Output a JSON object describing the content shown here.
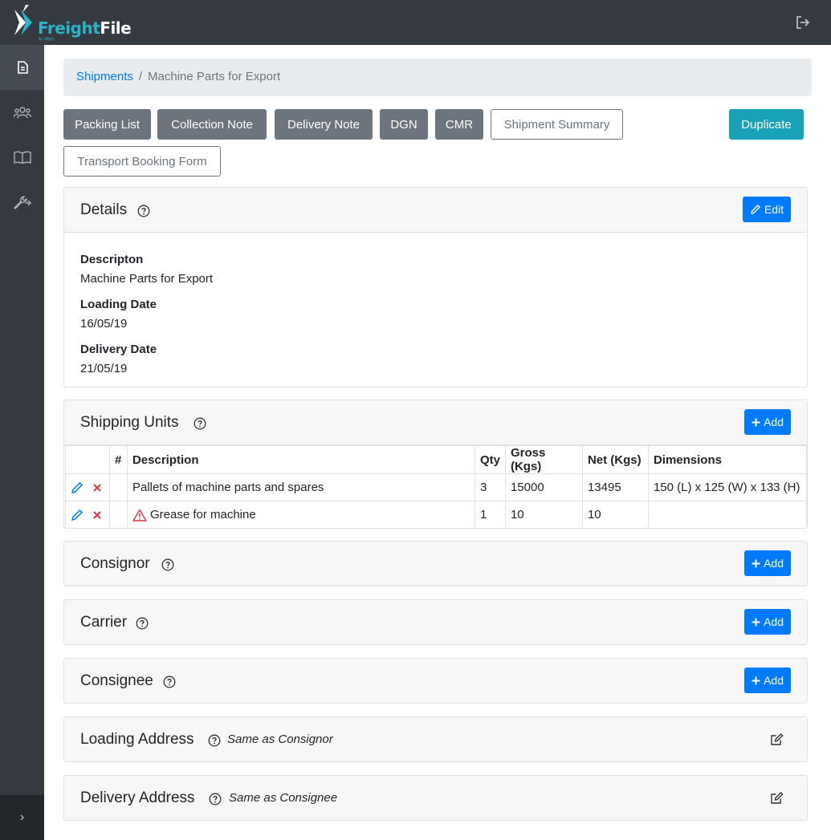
{
  "brand": {
    "name_part1": "Freight",
    "name_part2": "File",
    "byline": "by Sitpro",
    "accent": "#2bb3c9"
  },
  "topbar": {
    "logout_icon": "sign-out-icon"
  },
  "sidebar": {
    "items": [
      {
        "icon": "file-icon",
        "active": true
      },
      {
        "icon": "users-icon",
        "active": false
      },
      {
        "icon": "book-icon",
        "active": false
      },
      {
        "icon": "tools-icon",
        "active": false
      }
    ],
    "expand_icon": "chevron-right-icon",
    "expand_glyph": "›"
  },
  "breadcrumb": {
    "parent": "Shipments",
    "separator": "/",
    "current": "Machine Parts for Export"
  },
  "toolbar": {
    "packing_list": "Packing List",
    "collection_note": "Collection Note",
    "delivery_note": "Delivery Note",
    "dgn": "DGN",
    "cmr": "CMR",
    "shipment_summary": "Shipment Summary",
    "transport_booking_form": "Transport Booking Form",
    "duplicate": "Duplicate"
  },
  "details": {
    "title": "Details",
    "edit_label": "Edit",
    "description_label": "Descripton",
    "description_value": "Machine Parts for Export",
    "loading_date_label": "Loading Date",
    "loading_date_value": "16/05/19",
    "delivery_date_label": "Delivery Date",
    "delivery_date_value": "21/05/19"
  },
  "shipping_units": {
    "title": "Shipping Units",
    "add_label": "Add",
    "columns": [
      "",
      "#",
      "Description",
      "Qty",
      "Gross (Kgs)",
      "Net (Kgs)",
      "Dimensions"
    ],
    "rows": [
      {
        "number": "",
        "description": "Pallets of machine parts and spares",
        "qty": "3",
        "gross": "15000",
        "net": "13495",
        "dimensions": "150 (L) x 125 (W) x 133 (H)",
        "hazardous": false
      },
      {
        "number": "",
        "description": "Grease for machine",
        "qty": "1",
        "gross": "10",
        "net": "10",
        "dimensions": "",
        "hazardous": true
      }
    ]
  },
  "consignor": {
    "title": "Consignor",
    "add_label": "Add"
  },
  "carrier": {
    "title": "Carrier",
    "add_label": "Add"
  },
  "consignee": {
    "title": "Consignee",
    "add_label": "Add"
  },
  "loading_address": {
    "title": "Loading Address",
    "note": "Same as Consignor"
  },
  "delivery_address": {
    "title": "Delivery Address",
    "note": "Same as Consignee"
  },
  "colors": {
    "primary": "#007bff",
    "secondary": "#6c757d",
    "info": "#17a2b8",
    "danger": "#dc3545",
    "dark": "#343a40"
  }
}
